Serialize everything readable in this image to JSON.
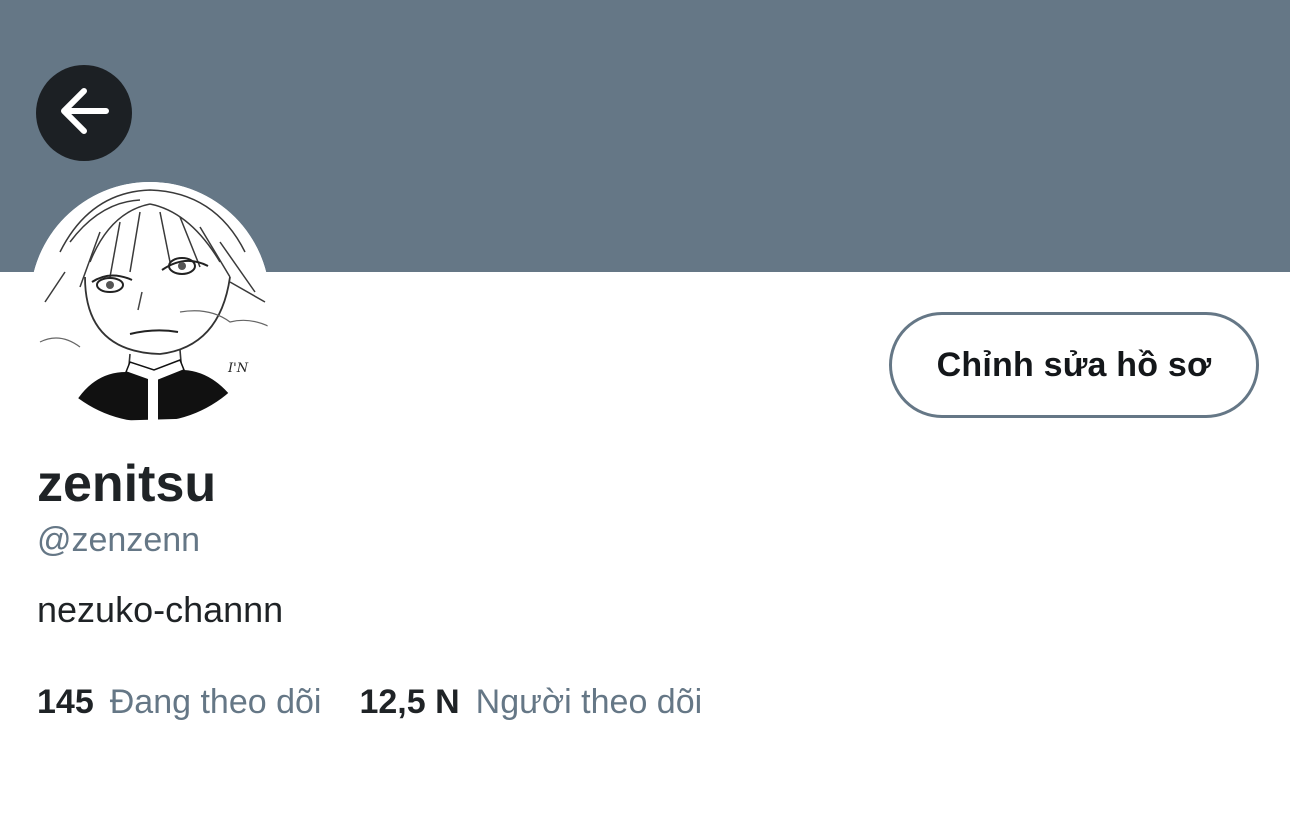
{
  "header": {
    "banner_color": "#657786",
    "back_icon": "arrow-left-icon"
  },
  "profile": {
    "display_name": "zenitsu",
    "handle": "@zenzenn",
    "bio": "nezuko-channn",
    "avatar_text": "I'N",
    "edit_button_label": "Chỉnh sửa hồ sơ"
  },
  "stats": {
    "following_count": "145",
    "following_label": "Đang theo dõi",
    "followers_count": "12,5 N",
    "followers_label": "Người theo dõi"
  }
}
